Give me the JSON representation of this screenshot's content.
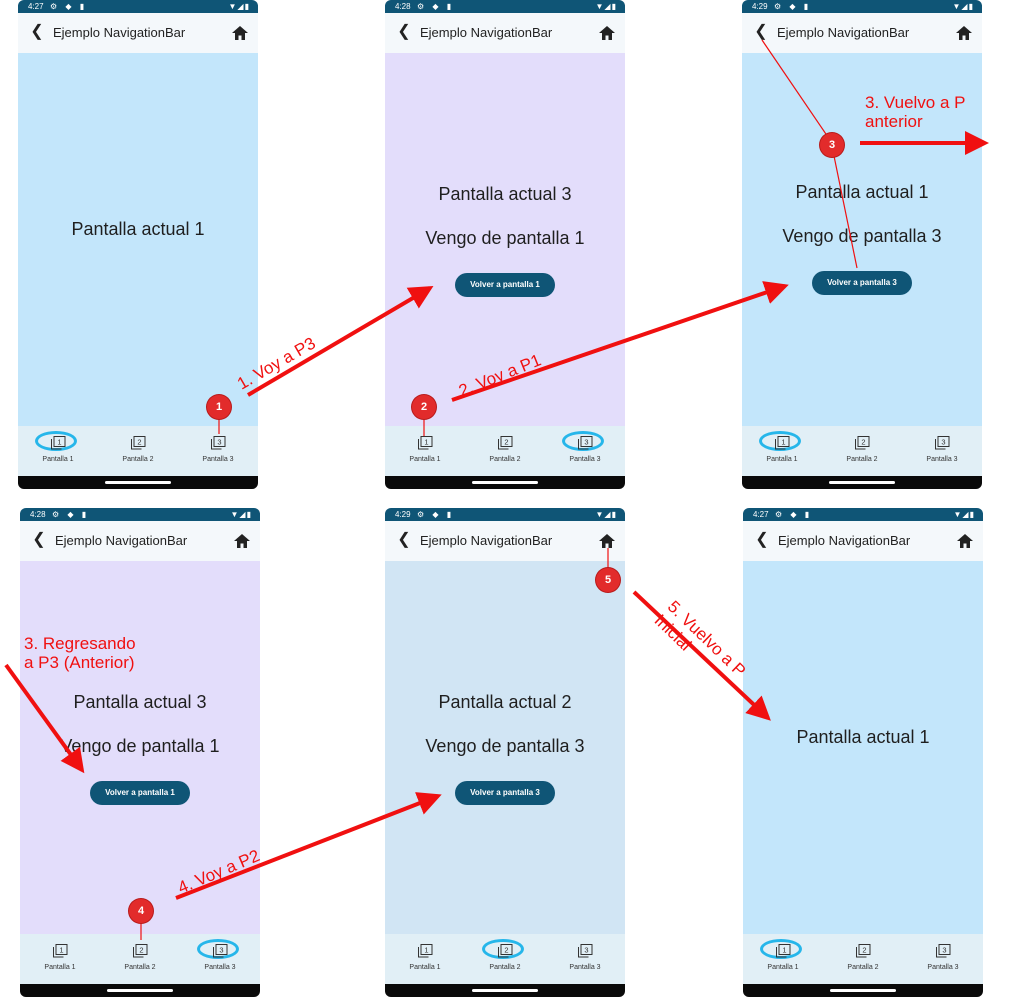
{
  "phones": [
    {
      "id": "a",
      "time": "4:27",
      "title": "Ejemplo NavigationBar",
      "theme": "blue",
      "line1": "Pantalla actual 1",
      "line2": "",
      "button": "",
      "selected": 0
    },
    {
      "id": "b",
      "time": "4:28",
      "title": "Ejemplo NavigationBar",
      "theme": "purple",
      "line1": "Pantalla actual 3",
      "line2": "Vengo de pantalla 1",
      "button": "Volver a pantalla 1",
      "selected": 2
    },
    {
      "id": "c",
      "time": "4:29",
      "title": "Ejemplo NavigationBar",
      "theme": "blue",
      "line1": "Pantalla actual 1",
      "line2": "Vengo de pantalla 3",
      "button": "Volver a pantalla 3",
      "selected": 0
    },
    {
      "id": "d",
      "time": "4:28",
      "title": "Ejemplo NavigationBar",
      "theme": "purple",
      "line1": "Pantalla actual 3",
      "line2": "Vengo de pantalla 1",
      "button": "Volver a pantalla 1",
      "selected": 2
    },
    {
      "id": "e",
      "time": "4:29",
      "title": "Ejemplo NavigationBar",
      "theme": "lblue",
      "line1": "Pantalla actual 2",
      "line2": "Vengo de pantalla 3",
      "button": "Volver a pantalla 3",
      "selected": 1
    },
    {
      "id": "f",
      "time": "4:27",
      "title": "Ejemplo NavigationBar",
      "theme": "blue",
      "line1": "Pantalla actual 1",
      "line2": "",
      "button": "",
      "selected": 0
    }
  ],
  "nav_items": [
    {
      "label": "Pantalla 1",
      "icon": "filter-1-icon",
      "digit": "1"
    },
    {
      "label": "Pantalla 2",
      "icon": "filter-2-icon",
      "digit": "2"
    },
    {
      "label": "Pantalla 3",
      "icon": "filter-3-icon",
      "digit": "3"
    }
  ],
  "annotations": {
    "a1": "1. Voy a P3",
    "a2": "2. Voy a P1",
    "a3_top": "3. Vuelvo a P\nanterior",
    "a3_left": "3. Regresando\na P3 (Anterior)",
    "a4": "4. Voy a P2",
    "a5": "5. Vuelvo a P\nInicial"
  },
  "badges": [
    "1",
    "2",
    "3",
    "4",
    "5"
  ],
  "colors": {
    "status_bar": "#0f5576",
    "button": "#0f5576",
    "annotation": "#f01010",
    "badge": "#e22b2b",
    "selection_ring": "#26b6ea",
    "bg_blue": "#c3e6fb",
    "bg_purple": "#e3ddfb",
    "bg_lblue": "#d1e5f4"
  }
}
